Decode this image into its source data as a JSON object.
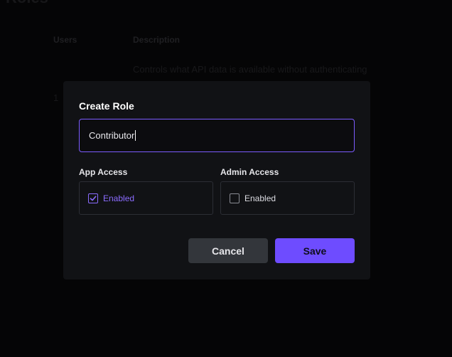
{
  "background": {
    "columns": {
      "users": "Users",
      "description": "Description"
    },
    "row": {
      "users": "1",
      "description": "Controls what API data is available without authenticating"
    }
  },
  "modal": {
    "title": "Create Role",
    "role_name_input": {
      "value": "Contributor"
    },
    "app_access": {
      "label": "App Access",
      "checkbox_label": "Enabled",
      "checked": true
    },
    "admin_access": {
      "label": "Admin Access",
      "checkbox_label": "Enabled",
      "checked": false
    },
    "cancel_label": "Cancel",
    "save_label": "Save"
  },
  "colors": {
    "accent": "#6e4cff",
    "accent_text": "#8b6cff",
    "modal_bg": "#111215",
    "cancel_bg": "#33363b"
  },
  "icons": {
    "check": "check-icon"
  }
}
